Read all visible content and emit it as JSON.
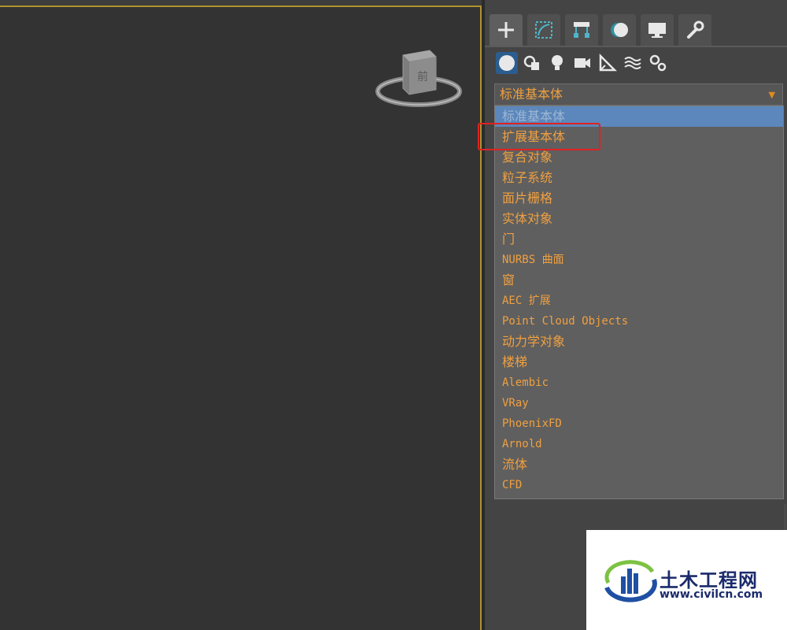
{
  "viewport": {
    "viewcube_label": "前"
  },
  "tabs": [
    {
      "name": "create",
      "icon": "plus-icon",
      "active": true
    },
    {
      "name": "modify",
      "icon": "modify-curve-icon",
      "active": false
    },
    {
      "name": "hierarchy",
      "icon": "hierarchy-icon",
      "active": false
    },
    {
      "name": "motion",
      "icon": "motion-icon",
      "active": false
    },
    {
      "name": "display",
      "icon": "display-monitor-icon",
      "active": false
    },
    {
      "name": "utilities",
      "icon": "wrench-icon",
      "active": false
    }
  ],
  "categories": [
    {
      "icon": "geometry-sphere-icon",
      "active": true
    },
    {
      "icon": "shapes-icon",
      "active": false
    },
    {
      "icon": "lights-bulb-icon",
      "active": false
    },
    {
      "icon": "camera-icon",
      "active": false
    },
    {
      "icon": "helpers-ruler-icon",
      "active": false
    },
    {
      "icon": "space-warps-icon",
      "active": false
    },
    {
      "icon": "systems-gears-icon",
      "active": false
    }
  ],
  "combo": {
    "value": "标准基本体"
  },
  "dropdown": {
    "items": [
      "标准基本体",
      "扩展基本体",
      "复合对象",
      "粒子系统",
      "面片栅格",
      "实体对象",
      "门",
      "NURBS 曲面",
      "窗",
      "AEC 扩展",
      "Point Cloud Objects",
      "动力学对象",
      "楼梯",
      "Alembic",
      "VRay",
      "PhoenixFD",
      "Arnold",
      "流体",
      "CFD"
    ],
    "selected_index": 0,
    "highlighted_index": 1
  },
  "watermark": {
    "title": "土木工程网",
    "url": "www.civilcn.com"
  },
  "colors": {
    "accent_text": "#f0a040",
    "selection": "#5b87bc",
    "highlight_box": "#e22020",
    "viewport_border": "#b0922e",
    "watermark_blue": "#1b2a6b"
  }
}
